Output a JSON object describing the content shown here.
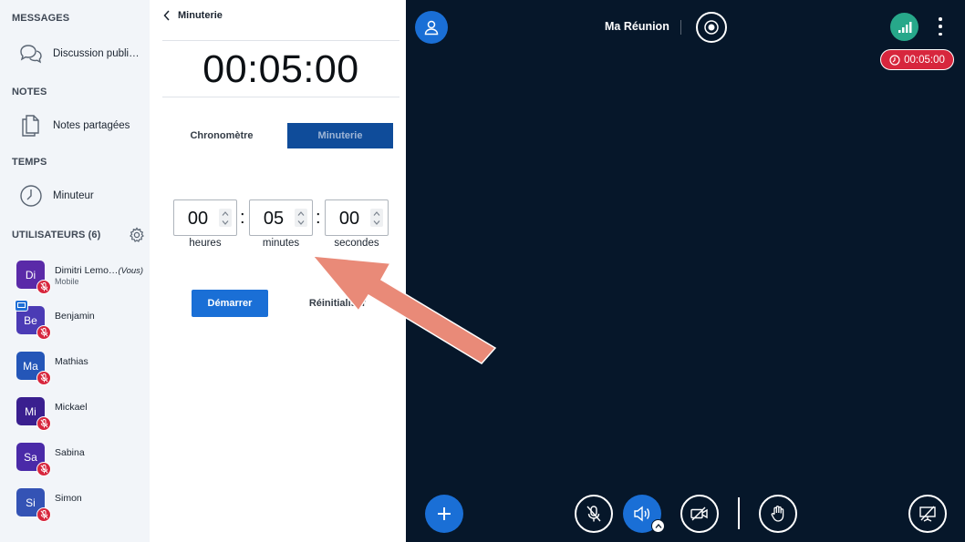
{
  "sidebar": {
    "messages": {
      "heading": "MESSAGES",
      "public_chat": "Discussion publi…"
    },
    "notes": {
      "heading": "NOTES",
      "shared_notes": "Notes partagées"
    },
    "time": {
      "heading": "TEMPS",
      "timer": "Minuteur"
    },
    "users": {
      "heading": "UTILISATEURS (6)",
      "list": [
        {
          "initials": "Di",
          "name": "Dimitri Lemo…",
          "you": "(Vous)",
          "sub": "Mobile",
          "color": "#5a2aa8"
        },
        {
          "initials": "Be",
          "name": "Benjamin",
          "color": "#4b3bb5"
        },
        {
          "initials": "Ma",
          "name": "Mathias",
          "color": "#2456b8"
        },
        {
          "initials": "Mi",
          "name": "Mickael",
          "color": "#3a1f8f"
        },
        {
          "initials": "Sa",
          "name": "Sabina",
          "color": "#4a2aa8"
        },
        {
          "initials": "Si",
          "name": "Simon",
          "color": "#3453b5"
        }
      ]
    }
  },
  "timer_panel": {
    "back_label": "Minuterie",
    "display": "00:05:00",
    "tabs": {
      "stopwatch": "Chronomètre",
      "timer": "Minuterie"
    },
    "fields": {
      "hours": {
        "value": "00",
        "label": "heures"
      },
      "minutes": {
        "value": "05",
        "label": "minutes"
      },
      "seconds": {
        "value": "00",
        "label": "secondes"
      }
    },
    "separator": ":",
    "start_label": "Démarrer",
    "reset_label": "Réinitialiser"
  },
  "meeting": {
    "title": "Ma Réunion",
    "timer_badge": "00:05:00",
    "colors": {
      "accent": "#1a6fd6",
      "danger": "#d7263d",
      "connection": "#27a88a",
      "background": "#06172a"
    }
  },
  "annotation": {
    "arrow_color": "#e98a78"
  }
}
